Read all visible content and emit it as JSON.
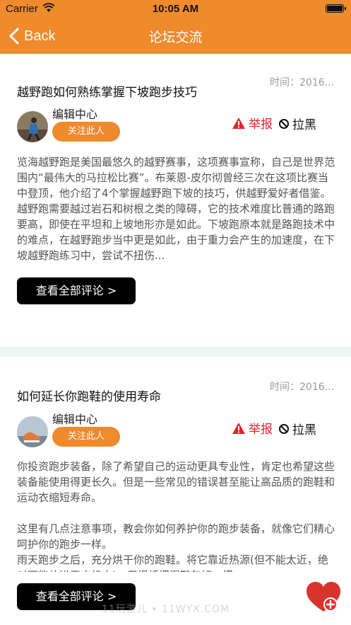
{
  "status_bar": {
    "carrier": "Carrier",
    "time": "10:05 AM"
  },
  "nav": {
    "back_label": "Back",
    "title": "论坛交流"
  },
  "posts": [
    {
      "time": "时间：2016...",
      "title": "越野跑如何熟练掌握下坡跑步技巧",
      "author": "编辑中心",
      "follow_label": "关注此人",
      "report_label": "举报",
      "block_label": "拉黑",
      "content": "览海越野跑是美国最悠久的越野赛事，这项赛事宣称，自己是世界范围内“最伟大的马拉松比赛”。布莱恩-皮尔彻曾经三次在这项比赛当中登顶，他介绍了4个掌握越野跑下坡的技巧，供越野爱好者借鉴。\n越野跑需要越过岩石和树根之类的障碍，它的技术难度比普通的路跑要高，即使在平坦和上坡地形亦是如此。下坡跑原本就是路跑技术中的难点，在越野跑步当中更是如此，由于重力会产生的加速度，在下坡越野跑练习中，尝试不扭伤...",
      "comments_label": "查看全部评论 >"
    },
    {
      "time": "时间：2016...",
      "title": "如何延长你跑鞋的使用寿命",
      "author": "编辑中心",
      "follow_label": "关注此人",
      "report_label": "举报",
      "block_label": "拉黑",
      "content": "你投资跑步装备，除了希望自己的运动更具专业性，肯定也希望这些装备能使用得更长久。但是一些常见的错误甚至能让高品质的跑鞋和运动衣缩短寿命。\n\n这里有几点注意事项，教会你如何养护你的跑步装备，就像它们精心呵护你的跑步一样。\n雨天跑步之后，充分烘干你的跑鞋。将它靠近热源(但不能太近，绝对不能放进干衣机中)，用报纸把湿鞋包好，把...",
      "comments_label": "查看全部评论 >"
    }
  ],
  "watermark": "11玩游儿 • 11WYX.COM",
  "colors": {
    "accent": "#ef8a2d",
    "report": "#e0242b",
    "separator": "#eef5f3"
  }
}
